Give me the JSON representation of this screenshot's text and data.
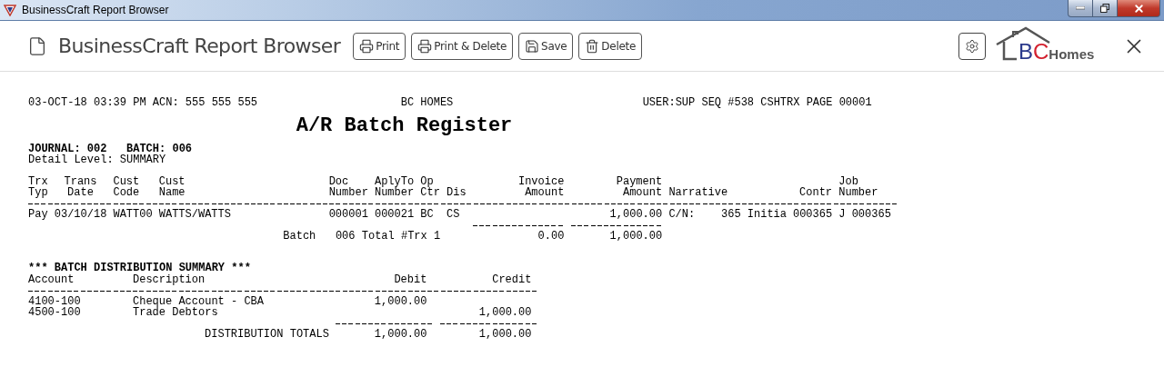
{
  "window": {
    "title": "BusinessCraft Report Browser"
  },
  "app_bar": {
    "title": "BusinessCraft Report Browser",
    "buttons": [
      {
        "kind": "print",
        "label": "Print"
      },
      {
        "kind": "print",
        "label": "Print & Delete"
      },
      {
        "kind": "save",
        "label": "Save"
      },
      {
        "kind": "delete",
        "label": "Delete"
      }
    ],
    "logo": [
      "B",
      "C",
      "Homes"
    ]
  },
  "report": {
    "header_left": "03-OCT-18 03:39 PM ACN: 555 555 555",
    "header_center": "BC HOMES",
    "header_right": "USER:SUP SEQ #538 CSHTRX PAGE 00001",
    "title": "A/R Batch Register",
    "journal": "JOURNAL: 002   BATCH: 006",
    "detail_level": "Detail Level: SUMMARY",
    "columns": [
      {
        "top": "Trx",
        "bottom": "Typ"
      },
      {
        "top": "Trans",
        "bottom": "Date"
      },
      {
        "top": "Cust",
        "bottom": "Code"
      },
      {
        "top": "Cust",
        "bottom": "Name"
      },
      {
        "top": "Doc",
        "bottom": "Number"
      },
      {
        "top": "AplyTo",
        "bottom": "Number"
      },
      {
        "top": "Op",
        "bottom": "Ctr"
      },
      {
        "bottom": "Dis"
      },
      {
        "top": "Invoice",
        "bottom": "Amount"
      },
      {
        "top": "Payment",
        "bottom": "Amount"
      },
      {
        "bottom": "Narrative"
      },
      {
        "bottom": "Contr"
      },
      {
        "top": "Job",
        "bottom": "Number"
      }
    ],
    "rows": [
      [
        "Pay",
        "03/10/18",
        "WATT00",
        "WATTS/WATTS",
        "000001",
        "000021",
        "BC",
        "CS",
        "",
        "1,000.00",
        "C/N:    365 Initia",
        "000365",
        "J 000365"
      ]
    ],
    "batch_total": {
      "label": "Batch   006 Total #Trx 1",
      "invoice": "0.00",
      "payment": "1,000.00"
    },
    "distribution": {
      "title": "*** BATCH DISTRIBUTION SUMMARY ***",
      "columns": [
        "Account",
        "Description",
        "Debit",
        "Credit"
      ],
      "rows": [
        [
          "4100-100",
          "Cheque Account - CBA",
          "1,000.00",
          ""
        ],
        [
          "4500-100",
          "Trade Debtors",
          "",
          "1,000.00"
        ]
      ],
      "totals": {
        "label": "DISTRIBUTION TOTALS",
        "debit": "1,000.00",
        "credit": "1,000.00"
      }
    }
  }
}
